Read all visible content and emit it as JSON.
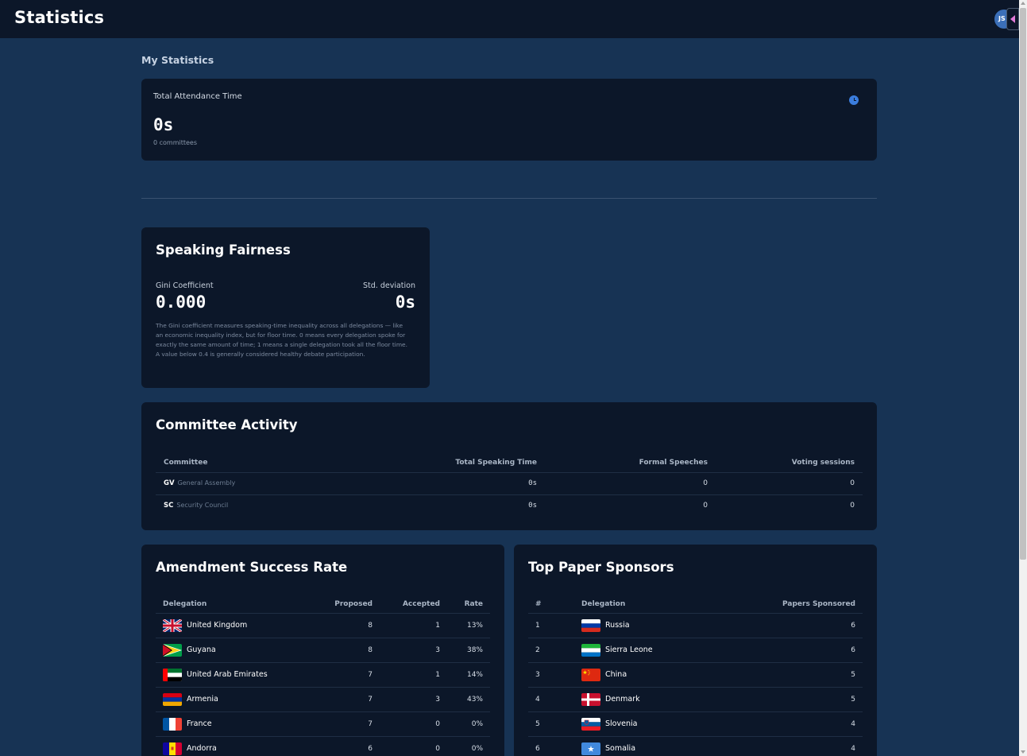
{
  "header": {
    "title": "Statistics",
    "avatar_initials": "JS"
  },
  "my_stats": {
    "section_label": "My Statistics",
    "attendance_label": "Total Attendance Time",
    "attendance_value": "0s",
    "attendance_sub": "0 committees"
  },
  "fairness": {
    "title": "Speaking Fairness",
    "gini_label": "Gini Coefficient",
    "gini_value": "0.000",
    "std_label": "Std. deviation",
    "std_value": "0s",
    "description": "The Gini coefficient measures speaking-time inequality across all delegations — like an economic inequality index, but for floor time. 0 means every delegation spoke for exactly the same amount of time; 1 means a single delegation took all the floor time. A value below 0.4 is generally considered healthy debate participation."
  },
  "activity": {
    "title": "Committee Activity",
    "headers": [
      "Committee",
      "Total Speaking Time",
      "Formal Speeches",
      "Voting sessions"
    ],
    "rows": [
      {
        "abbr": "GV",
        "name": "General Assembly",
        "speaking_time": "0s",
        "speeches": "0",
        "voting": "0"
      },
      {
        "abbr": "SC",
        "name": "Security Council",
        "speaking_time": "0s",
        "speeches": "0",
        "voting": "0"
      }
    ]
  },
  "amendments": {
    "title": "Amendment Success Rate",
    "headers": [
      "Delegation",
      "Proposed",
      "Accepted",
      "Rate"
    ],
    "rows": [
      {
        "delegation": "United Kingdom",
        "flag": "uk-flag",
        "proposed": "8",
        "accepted": "1",
        "rate": "13%"
      },
      {
        "delegation": "Guyana",
        "flag": "guyana-flag",
        "proposed": "8",
        "accepted": "3",
        "rate": "38%"
      },
      {
        "delegation": "United Arab Emirates",
        "flag": "uae-flag",
        "proposed": "7",
        "accepted": "1",
        "rate": "14%"
      },
      {
        "delegation": "Armenia",
        "flag": "armenia-flag",
        "proposed": "7",
        "accepted": "3",
        "rate": "43%"
      },
      {
        "delegation": "France",
        "flag": "france-flag",
        "proposed": "7",
        "accepted": "0",
        "rate": "0%"
      },
      {
        "delegation": "Andorra",
        "flag": "andorra-flag",
        "proposed": "6",
        "accepted": "0",
        "rate": "0%"
      }
    ]
  },
  "sponsors": {
    "title": "Top Paper Sponsors",
    "headers": [
      "#",
      "Delegation",
      "Papers Sponsored"
    ],
    "rows": [
      {
        "rank": "1",
        "delegation": "Russia",
        "flag": "russia-flag",
        "papers": "6"
      },
      {
        "rank": "2",
        "delegation": "Sierra Leone",
        "flag": "sierra-leone-flag",
        "papers": "6"
      },
      {
        "rank": "3",
        "delegation": "China",
        "flag": "china-flag",
        "papers": "5"
      },
      {
        "rank": "4",
        "delegation": "Denmark",
        "flag": "denmark-flag",
        "papers": "5"
      },
      {
        "rank": "5",
        "delegation": "Slovenia",
        "flag": "slovenia-flag",
        "papers": "4"
      },
      {
        "rank": "6",
        "delegation": "Somalia",
        "flag": "somalia-flag",
        "papers": "4"
      }
    ]
  }
}
